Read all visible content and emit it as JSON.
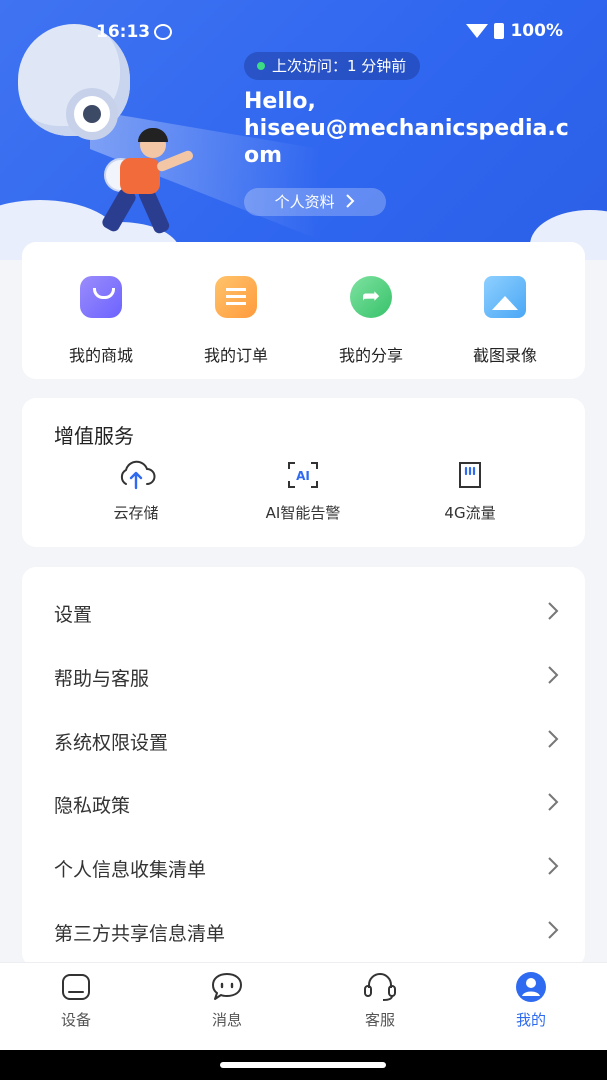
{
  "status_bar": {
    "time": "16:13",
    "battery": "100%"
  },
  "header": {
    "last_visit": "上次访问：1 分钟前",
    "greeting": "Hello,",
    "email": "hiseeu@mechanicspedia.com",
    "profile_link": "个人资料",
    "colors": {
      "primary": "#2f66f0"
    }
  },
  "quick_actions": [
    {
      "label": "我的商城",
      "icon": "shopping-bag-icon"
    },
    {
      "label": "我的订单",
      "icon": "order-list-icon"
    },
    {
      "label": "我的分享",
      "icon": "share-icon"
    },
    {
      "label": "截图录像",
      "icon": "image-icon"
    }
  ],
  "value_services": {
    "title": "增值服务",
    "items": [
      {
        "label": "云存储",
        "icon": "cloud-upload-icon"
      },
      {
        "label": "AI智能告警",
        "icon": "ai-icon"
      },
      {
        "label": "4G流量",
        "icon": "sim-card-icon"
      }
    ]
  },
  "menu": [
    {
      "label": "设置"
    },
    {
      "label": "帮助与客服"
    },
    {
      "label": "系统权限设置"
    },
    {
      "label": "隐私政策"
    },
    {
      "label": "个人信息收集清单"
    },
    {
      "label": "第三方共享信息清单"
    }
  ],
  "bottom_nav": [
    {
      "label": "设备",
      "icon": "device-icon",
      "active": false
    },
    {
      "label": "消息",
      "icon": "message-icon",
      "active": false
    },
    {
      "label": "客服",
      "icon": "headset-icon",
      "active": false
    },
    {
      "label": "我的",
      "icon": "user-icon",
      "active": true
    }
  ],
  "accent_color": "#2f6bf0"
}
